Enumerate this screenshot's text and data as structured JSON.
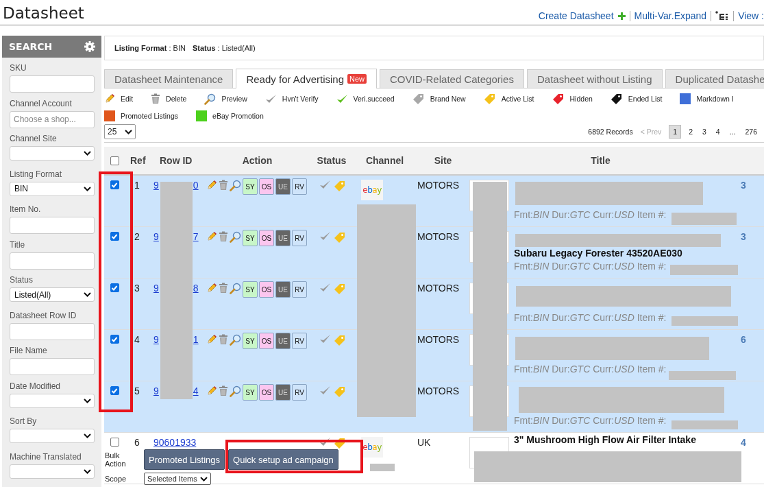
{
  "page_title": "Datasheet",
  "header_links": [
    {
      "label": "Create Datasheet",
      "kind": "create"
    },
    {
      "label": "Multi-Var.Expand",
      "kind": "text"
    },
    {
      "kind": "tree"
    },
    {
      "label": "View :",
      "kind": "text"
    }
  ],
  "sidebar": {
    "title": "SEARCH",
    "fields": [
      {
        "label": "SKU",
        "kind": "input"
      },
      {
        "label": "Channel Account",
        "kind": "input",
        "placeholder": "Choose a shop..."
      },
      {
        "label": "Channel Site",
        "kind": "select"
      },
      {
        "label": "Listing Format",
        "kind": "select",
        "value": "BIN"
      },
      {
        "label": "Item No.",
        "kind": "input"
      },
      {
        "label": "Title",
        "kind": "input"
      },
      {
        "label": "Status",
        "kind": "select",
        "value": "Listed(All)"
      },
      {
        "label": "Datasheet Row ID",
        "kind": "input"
      },
      {
        "label": "File Name",
        "kind": "input"
      },
      {
        "label": "Date Modified",
        "kind": "select"
      },
      {
        "label": "Sort By",
        "kind": "select"
      },
      {
        "label": "Machine Translated",
        "kind": "select"
      }
    ]
  },
  "filters": [
    "**Listing Format** : BIN",
    "**Status** : Listed(All)"
  ],
  "tabs": [
    {
      "label": "Datasheet Maintenance",
      "selected": false
    },
    {
      "label": "Ready for Advertising",
      "selected": true,
      "badge": "New"
    },
    {
      "label": "COVID-Related Categories",
      "selected": false
    },
    {
      "label": "Datasheet without Listing",
      "selected": false
    },
    {
      "label": "Duplicated Datashe",
      "selected": false
    }
  ],
  "legend": [
    {
      "label": "Edit",
      "kind": "pencil"
    },
    {
      "label": "Delete",
      "kind": "trash"
    },
    {
      "label": "Preview",
      "kind": "magnifier"
    },
    {
      "label": "Hvn't Verify",
      "kind": "check",
      "color": "#9a9a9a"
    },
    {
      "label": "Veri.succeed",
      "kind": "check",
      "color": "#5cbf1c"
    },
    {
      "label": "Brand New",
      "kind": "tag",
      "color": "#a8a8a8"
    },
    {
      "label": "Active List",
      "kind": "tag",
      "color": "#f5c21b"
    },
    {
      "label": "Hidden",
      "kind": "tag",
      "color": "#e8222c"
    },
    {
      "label": "Ended List",
      "kind": "tag",
      "color": "#111111"
    },
    {
      "label": "Markdown I",
      "kind": "square",
      "color": "#3f6fd8"
    },
    {
      "label": "Promoted Listings",
      "kind": "square",
      "color": "#e0561c"
    },
    {
      "label": "eBay Promotion",
      "kind": "square",
      "color": "#4cd11c"
    }
  ],
  "pager": {
    "page_size": "25",
    "records": "6892 Records",
    "prev": {
      "label": "< Prev",
      "disabled": true
    },
    "pages": [
      {
        "label": "1",
        "selected": true
      },
      {
        "label": "2",
        "selected": false
      },
      {
        "label": "3",
        "selected": false
      },
      {
        "label": "4",
        "selected": false
      },
      {
        "label": "...",
        "selected": false
      },
      {
        "label": "276",
        "selected": false
      }
    ]
  },
  "table": {
    "select_all": {
      "checked": false
    },
    "columns": [
      "Ref",
      "Row ID",
      "Action",
      "Status",
      "Channel",
      "Site",
      "Title"
    ],
    "rows": [
      {
        "checked": true,
        "ref": "1",
        "row_id": [
          "9",
          "0"
        ],
        "actions": [
          {
            "label": "SY",
            "color": "#c8f6c8"
          },
          {
            "label": "OS",
            "color": "#fbc6ef"
          },
          {
            "label": "UE",
            "color": "#666666"
          },
          {
            "label": "RV",
            "color": "#cfe4fa"
          }
        ],
        "verified": false,
        "tag": {
          "color": "#f5c21b"
        },
        "channel_logo": "ebay",
        "site": "MOTORS",
        "meta": "Fmt:*BIN* Dur:*GTC* Curr:*USD* Item #:",
        "qty": "3"
      },
      {
        "checked": true,
        "ref": "2",
        "row_id": [
          "9",
          "7"
        ],
        "actions": [
          {
            "label": "SY",
            "color": "#c8f6c8"
          },
          {
            "label": "OS",
            "color": "#fbc6ef"
          },
          {
            "label": "UE",
            "color": "#666666"
          },
          {
            "label": "RV",
            "color": "#cfe4fa"
          }
        ],
        "verified": false,
        "tag": {
          "color": "#f5c21b"
        },
        "site": "MOTORS",
        "title": "Subaru Legacy Forester 43520AE030",
        "meta": "Fmt:*BIN* Dur:*GTC* Curr:*USD* Item #:",
        "qty": "3"
      },
      {
        "checked": true,
        "ref": "3",
        "row_id": [
          "9",
          "8"
        ],
        "actions": [
          {
            "label": "SY",
            "color": "#c8f6c8"
          },
          {
            "label": "OS",
            "color": "#fbc6ef"
          },
          {
            "label": "UE",
            "color": "#666666"
          },
          {
            "label": "RV",
            "color": "#cfe4fa"
          }
        ],
        "verified": false,
        "tag": {
          "color": "#f5c21b"
        },
        "site": "MOTORS",
        "meta": "Fmt:*BIN* Dur:*GTC* Curr:*USD* Item #:"
      },
      {
        "checked": true,
        "ref": "4",
        "row_id": [
          "9",
          "1"
        ],
        "actions": [
          {
            "label": "SY",
            "color": "#c8f6c8"
          },
          {
            "label": "OS",
            "color": "#fbc6ef"
          },
          {
            "label": "UE",
            "color": "#666666"
          },
          {
            "label": "RV",
            "color": "#cfe4fa"
          }
        ],
        "verified": false,
        "tag": {
          "color": "#f5c21b"
        },
        "site": "MOTORS",
        "meta": "Fmt:*BIN* Dur:*GTC* Curr:*USD* Item #:",
        "qty": "6"
      },
      {
        "checked": true,
        "ref": "5",
        "row_id": [
          "9",
          "4"
        ],
        "actions": [
          {
            "label": "SY",
            "color": "#c8f6c8"
          },
          {
            "label": "OS",
            "color": "#fbc6ef"
          },
          {
            "label": "UE",
            "color": "#666666"
          },
          {
            "label": "RV",
            "color": "#cfe4fa"
          }
        ],
        "verified": false,
        "tag": {
          "color": "#f5c21b"
        },
        "site": "MOTORS",
        "meta": "Fmt:*BIN* Dur:*GTC* Curr:*USD* Item #:"
      },
      {
        "checked": false,
        "ref": "6",
        "row_id": [
          "90601933"
        ],
        "verified": false,
        "tag": {
          "color": "#f5c21b"
        },
        "channel_logo": "ebay",
        "site": "UK",
        "title": "3\" Mushroom High Flow Air Filter Intake",
        "qty": "4"
      }
    ]
  },
  "bulk": {
    "label": "Bulk Action",
    "buttons": [
      "Promoted Listings",
      "Quick setup ad campaign"
    ],
    "scope_label": "Scope",
    "scope_value": "Selected Items"
  }
}
